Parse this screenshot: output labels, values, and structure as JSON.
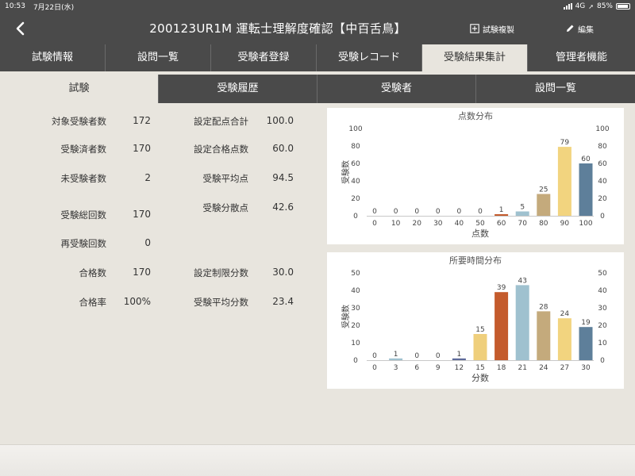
{
  "status": {
    "time": "10:53",
    "date": "7月22日(水)",
    "network": "4G",
    "battery": "85%"
  },
  "header": {
    "title": "200123UR1M 運転士理解度確認【中百舌鳥】",
    "copy_label": "試験複製",
    "edit_label": "編集"
  },
  "tabs": [
    {
      "label": "試験情報"
    },
    {
      "label": "設問一覧"
    },
    {
      "label": "受験者登録"
    },
    {
      "label": "受験レコード"
    },
    {
      "label": "受験結果集計"
    },
    {
      "label": "管理者機能"
    }
  ],
  "subtabs": [
    {
      "label": "試験"
    },
    {
      "label": "受験履歴"
    },
    {
      "label": "受験者"
    },
    {
      "label": "設問一覧"
    }
  ],
  "stats_left": [
    {
      "label": "対象受験者数",
      "value": "172"
    },
    {
      "label": "受験済者数",
      "value": "170"
    },
    {
      "label": "未受験者数",
      "value": "2"
    },
    {
      "label": "受験総回数",
      "value": "170"
    },
    {
      "label": "再受験回数",
      "value": "0"
    },
    {
      "label": "合格数",
      "value": "170"
    },
    {
      "label": "合格率",
      "value": "100%"
    }
  ],
  "stats_right": [
    {
      "label": "設定配点合計",
      "value": "100.0"
    },
    {
      "label": "設定合格点数",
      "value": "60.0"
    },
    {
      "label": "受験平均点",
      "value": "94.5"
    },
    {
      "label": "受験分散点",
      "value": "42.6"
    },
    {
      "label": "設定制限分数",
      "value": "30.0"
    },
    {
      "label": "受験平均分数",
      "value": "23.4"
    }
  ],
  "chart_data": [
    {
      "type": "bar",
      "title": "点数分布",
      "xlabel": "点数",
      "ylabel": "受験数",
      "ylim": [
        0,
        100
      ],
      "yticks": [
        0,
        20,
        40,
        60,
        80,
        100
      ],
      "categories": [
        "0",
        "10",
        "20",
        "30",
        "40",
        "50",
        "60",
        "70",
        "80",
        "90",
        "100"
      ],
      "values": [
        0,
        0,
        0,
        0,
        0,
        0,
        1,
        5,
        25,
        79,
        60
      ],
      "colors": [
        "#6a7fa8",
        "#6a7fa8",
        "#6a7fa8",
        "#6a7fa8",
        "#6a7fa8",
        "#6a7fa8",
        "#c45b2c",
        "#9fc1cf",
        "#c4aa7c",
        "#f2d47f",
        "#5e7f9a"
      ],
      "grid": false,
      "dual_y_axis": true
    },
    {
      "type": "bar",
      "title": "所要時間分布",
      "xlabel": "分数",
      "ylabel": "受験数",
      "ylim": [
        0,
        50
      ],
      "yticks": [
        0,
        10,
        20,
        30,
        40,
        50
      ],
      "categories": [
        "0",
        "3",
        "6",
        "9",
        "12",
        "15",
        "18",
        "21",
        "24",
        "27",
        "30"
      ],
      "values": [
        0,
        1,
        0,
        0,
        1,
        15,
        39,
        43,
        28,
        24,
        19
      ],
      "colors": [
        "#9fc1cf",
        "#9fc1cf",
        "#9fc1cf",
        "#9fc1cf",
        "#5e6a9a",
        "#efcf7c",
        "#c45b2c",
        "#9fc1cf",
        "#c4aa7c",
        "#f2d47f",
        "#5e7f9a"
      ],
      "grid": false,
      "dual_y_axis": true
    }
  ]
}
